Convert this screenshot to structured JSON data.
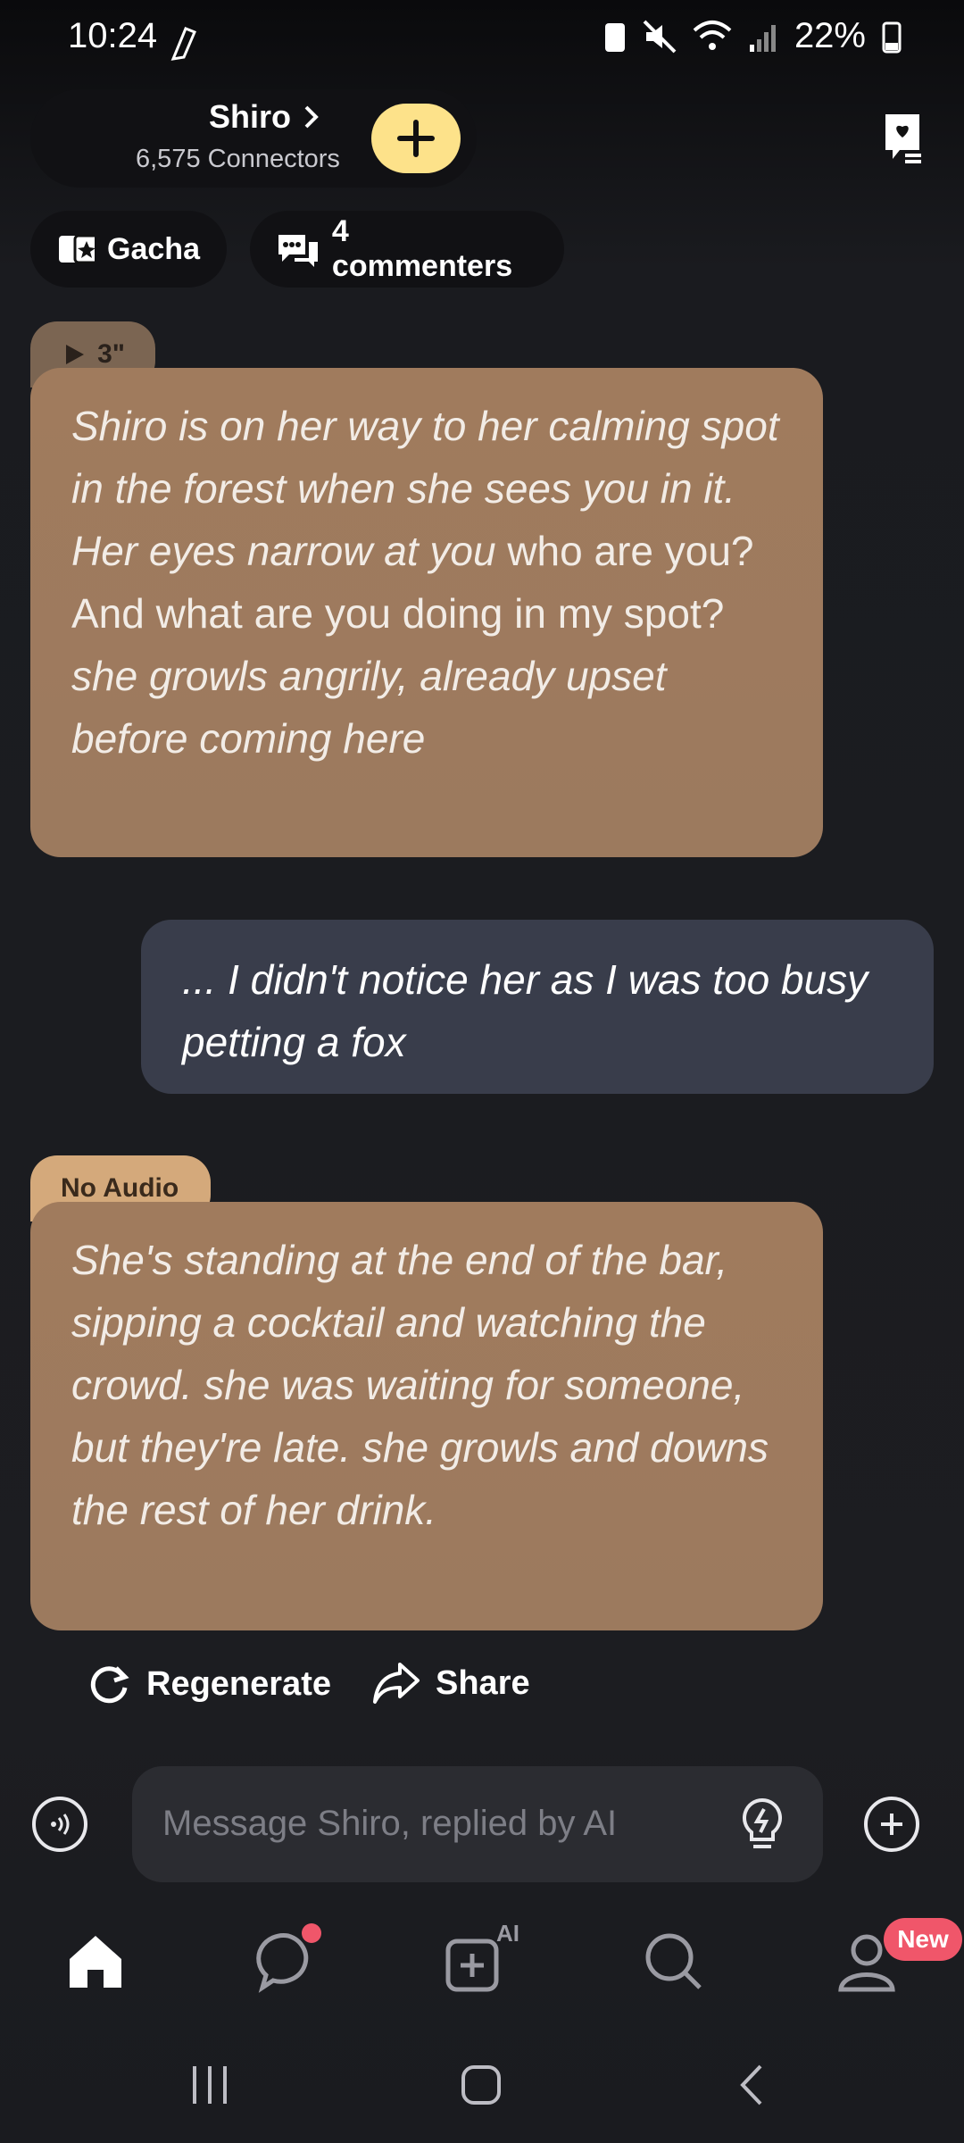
{
  "status_bar": {
    "time": "10:24",
    "battery": "22%"
  },
  "header": {
    "bot_name": "Shiro",
    "connectors": "6,575 Connectors"
  },
  "chips": {
    "gacha": "Gacha",
    "commenters": "4 commenters"
  },
  "messages": {
    "first": {
      "duration": "3\"",
      "italic_1": "Shiro is on her way to her calming spot in the forest when she sees you in it. Her eyes narrow at you",
      "normal": "who are you? And what are you doing in my spot?",
      "italic_2": "she growls angrily, already upset before coming here"
    },
    "user": {
      "text": "... I didn't notice her as I was too busy petting a fox"
    },
    "second": {
      "badge": "No Audio",
      "text": "She's standing at the end of the bar, sipping a cocktail and watching the crowd. she was waiting for someone, but they're late. she growls and downs the rest of her drink."
    }
  },
  "actions": {
    "regenerate": "Regenerate",
    "share": "Share"
  },
  "composer": {
    "placeholder": "Message Shiro, replied by AI"
  },
  "nav": {
    "ai_label": "AI",
    "new_badge": "New"
  },
  "colors": {
    "bot_bubble": "#9f7b5e",
    "user_bubble": "#393d4b",
    "accent_yellow": "#fde28a",
    "badge_pink": "#f0566a"
  }
}
